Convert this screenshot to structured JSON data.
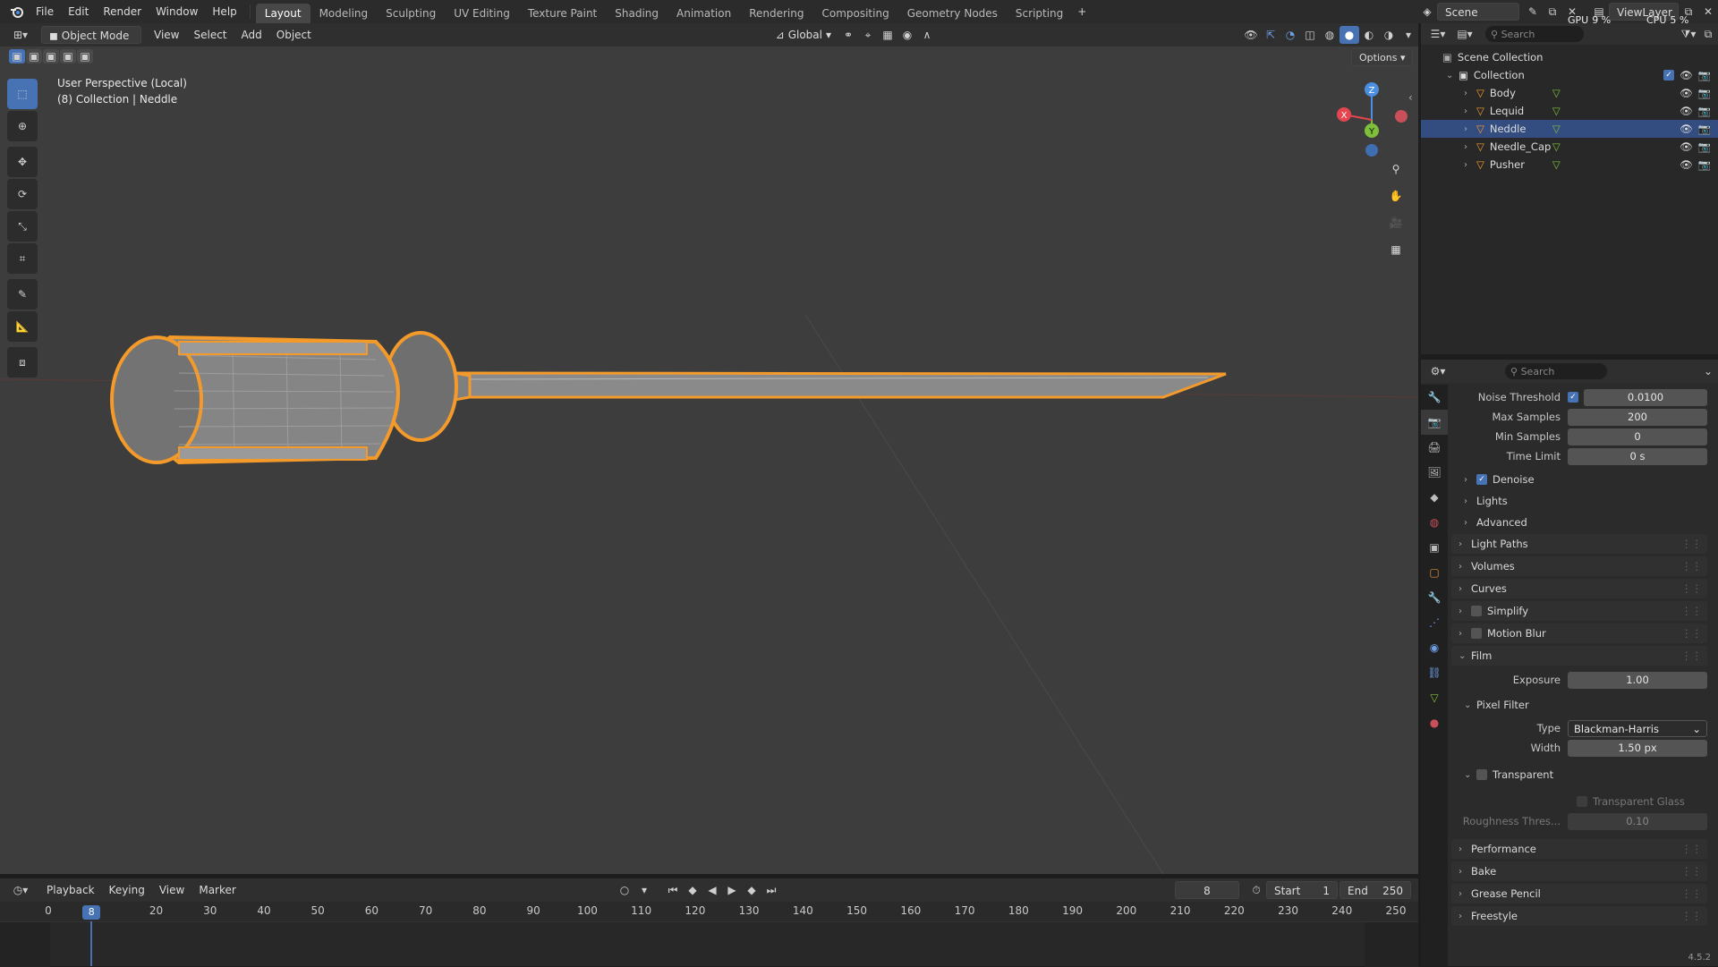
{
  "topbar": {
    "menus": [
      "File",
      "Edit",
      "Render",
      "Window",
      "Help"
    ],
    "workspaces": [
      "Layout",
      "Modeling",
      "Sculpting",
      "UV Editing",
      "Texture Paint",
      "Shading",
      "Animation",
      "Rendering",
      "Compositing",
      "Geometry Nodes",
      "Scripting"
    ],
    "active_workspace": "Layout",
    "scene": "Scene",
    "view_layer": "ViewLayer",
    "gpu_label": "GPU",
    "gpu_value": "9 %",
    "cpu_label": "CPU",
    "cpu_value": "5 %"
  },
  "viewport_header": {
    "mode": "Object Mode",
    "menus": [
      "View",
      "Select",
      "Add",
      "Object"
    ],
    "orientation": "Global",
    "options_label": "Options"
  },
  "viewport": {
    "line1": "User Perspective (Local)",
    "line2": "(8) Collection | Neddle",
    "gizmo_axes": [
      "Z",
      "Y",
      "X"
    ]
  },
  "timeline": {
    "menus": [
      "Playback",
      "Keying",
      "View",
      "Marker"
    ],
    "current_frame": "8",
    "start_label": "Start",
    "start_value": "1",
    "end_label": "End",
    "end_value": "250",
    "ticks": [
      "0",
      "20",
      "30",
      "40",
      "50",
      "60",
      "70",
      "80",
      "90",
      "100",
      "110",
      "120",
      "130",
      "140",
      "150",
      "160",
      "170",
      "180",
      "190",
      "200",
      "210",
      "220",
      "230",
      "240",
      "250"
    ],
    "cursor_label": "8"
  },
  "outliner": {
    "search_placeholder": "Search",
    "root": "Scene Collection",
    "collection": "Collection",
    "items": [
      {
        "name": "Body",
        "selected": false
      },
      {
        "name": "Lequid",
        "selected": false
      },
      {
        "name": "Neddle",
        "selected": true
      },
      {
        "name": "Needle_Cap",
        "selected": false
      },
      {
        "name": "Pusher",
        "selected": false
      }
    ]
  },
  "properties": {
    "search_placeholder": "Search",
    "noise_threshold_label": "Noise Threshold",
    "noise_threshold_value": "0.0100",
    "max_samples_label": "Max Samples",
    "max_samples_value": "200",
    "min_samples_label": "Min Samples",
    "min_samples_value": "0",
    "time_limit_label": "Time Limit",
    "time_limit_value": "0 s",
    "denoise_label": "Denoise",
    "lights_label": "Lights",
    "advanced_label": "Advanced",
    "panels": [
      "Light Paths",
      "Volumes",
      "Curves",
      "Simplify",
      "Motion Blur",
      "Film"
    ],
    "exposure_label": "Exposure",
    "exposure_value": "1.00",
    "pixel_filter_label": "Pixel Filter",
    "type_label": "Type",
    "type_value": "Blackman-Harris",
    "width_label": "Width",
    "width_value": "1.50 px",
    "transparent_label": "Transparent",
    "transparent_glass_label": "Transparent Glass",
    "roughness_label": "Roughness Thres...",
    "roughness_value": "0.10",
    "bottom_panels": [
      "Performance",
      "Bake",
      "Grease Pencil",
      "Freestyle"
    ],
    "version": "4.5.2"
  },
  "colors": {
    "accent": "#4772b3",
    "selection_orange": "#f39a2b",
    "x_axis": "#e5454f",
    "y_axis": "#7fc03a",
    "z_axis": "#4a8fe0"
  }
}
